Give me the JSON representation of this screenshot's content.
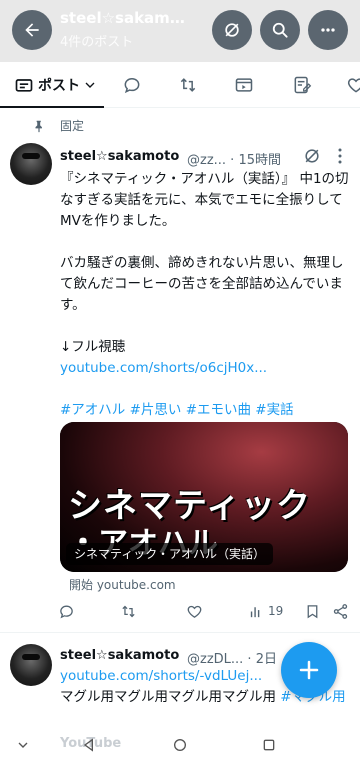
{
  "header": {
    "title": "steel☆sakamo...",
    "subtitle": "4件のポスト"
  },
  "tabs": {
    "posts_label": "ポスト"
  },
  "pinned": {
    "label": "固定"
  },
  "tweet1": {
    "name": "steel☆sakamoto",
    "handle_time": "@zz... · 15時間",
    "para1": "『シネマティック・アオハル（実話）』 中1の切なすぎる実話を元に、本気でエモに全振りしてMVを作りました。",
    "para2": "バカ騒ぎの裏側、諦めきれない片思い、無理して飲んだコーヒーの苦さを全部詰め込んでいます。",
    "para3_prefix": "↓フル視聴",
    "link": "youtube.com/shorts/o6cjH0x...",
    "hashtags": "#アオハル #片思い #エモい曲 #実話",
    "card": {
      "line1": "シネマティック",
      "line2": "・アオハル",
      "pill": "シネマティック・アオハル（実話）",
      "source": "開始 youtube.com"
    },
    "views": "19"
  },
  "tweet2": {
    "name": "steel☆sakamoto",
    "handle_time": "@zzDL... · 2日",
    "link": "youtube.com/shorts/-vdLUej...",
    "text_plain": "マグル用マグル用マグル用マグル用",
    "text_tag": "#マグル用"
  },
  "nav": {
    "faded_label": "YouTube"
  }
}
